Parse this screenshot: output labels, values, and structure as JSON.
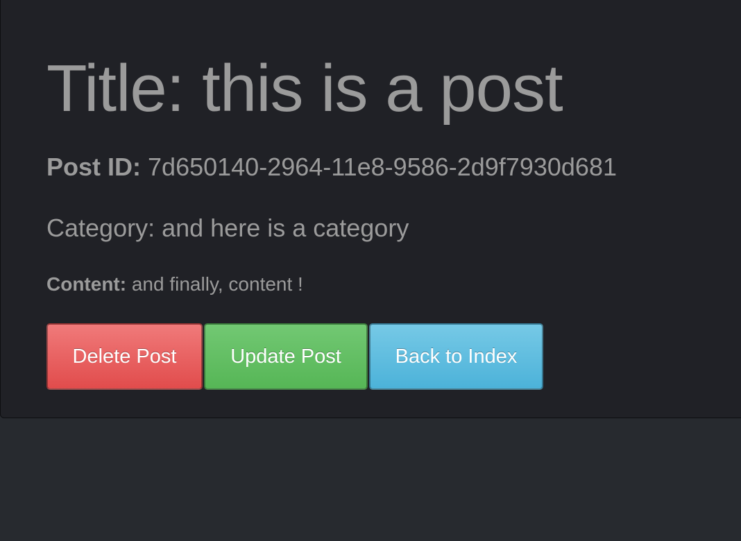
{
  "post": {
    "title": "Title: this is a post",
    "id_label": "Post ID:",
    "id_value": "7d650140-2964-11e8-9586-2d9f7930d681",
    "category_label": "Category:",
    "category_value": "and here is a category",
    "content_label": "Content:",
    "content_value": "and finally, content !"
  },
  "actions": {
    "delete_label": "Delete Post",
    "update_label": "Update Post",
    "back_label": "Back to Index"
  },
  "colors": {
    "page_bg": "#272a2f",
    "panel_bg": "#202126",
    "text": "#9b9b9b",
    "danger": "#e96060",
    "success": "#5cbd5c",
    "info": "#5bbde0"
  }
}
